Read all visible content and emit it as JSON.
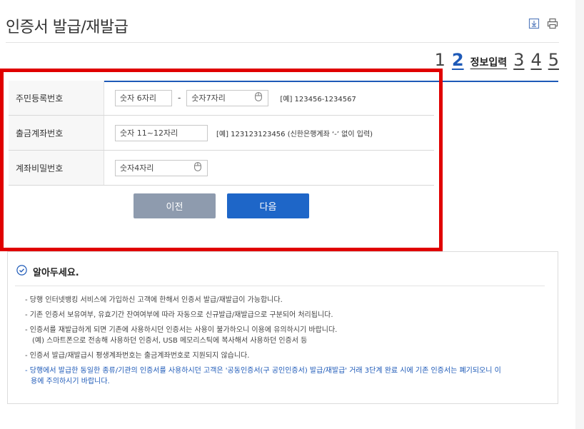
{
  "page": {
    "title": "인증서 발급/재발급"
  },
  "steps": {
    "items": [
      "1",
      "2",
      "3",
      "4",
      "5"
    ],
    "active_label": "정보입력"
  },
  "form": {
    "rows": [
      {
        "label": "주민등록번호",
        "inputs": [
          "숫자 6자리",
          "숫자7자리"
        ],
        "hint": "[예] 123456-1234567"
      },
      {
        "label": "출금계좌번호",
        "inputs": [
          "숫자 11~12자리"
        ],
        "hint": "[예] 123123123456 (신한은행계좌 ‘-’ 없이 입력)"
      },
      {
        "label": "계좌비밀번호",
        "inputs": [
          "숫자4자리"
        ],
        "hint": ""
      }
    ],
    "dash": "-",
    "prev_label": "이전",
    "next_label": "다음"
  },
  "notice": {
    "title": "알아두세요.",
    "items": [
      "- 당행 인터넷뱅킹 서비스에 가입하신 고객에 한해서 인증서 발급/재발급이 가능합니다.",
      "- 기존 인증서 보유여부, 유효기간 잔여여부에 따라 자동으로 신규발급/재발급으로 구분되어 처리됩니다.",
      "- 인증서를 재발급하게 되면 기존에 사용하시던 인증서는 사용이 불가하오니 이용에 유의하시기 바랍니다.",
      "(예) 스마트폰으로 전송해 사용하던 인증서, USB 메모리스틱에 복사해서 사용하던 인증서 등",
      "- 인증서 발급/재발급시 평생계좌번호는 출금계좌번호로 지원되지 않습니다.",
      "- 당행에서 발급한 동일한 종류/기관의 인증서를 사용하시던 고객은 '공동인증서(구 공인인증서) 발급/재발급' 거래 3단계 완료 시에 기존 인증서는 폐기되오니 이",
      "용에 주의하시기 바랍니다."
    ]
  },
  "colors": {
    "accent": "#1e5ab8",
    "highlight": "#e00000",
    "prev_button": "#8e9bae",
    "next_button": "#1e66c8"
  },
  "icons": [
    "download-icon",
    "print-icon",
    "mouse-keypad-icon",
    "check-circle-icon"
  ]
}
